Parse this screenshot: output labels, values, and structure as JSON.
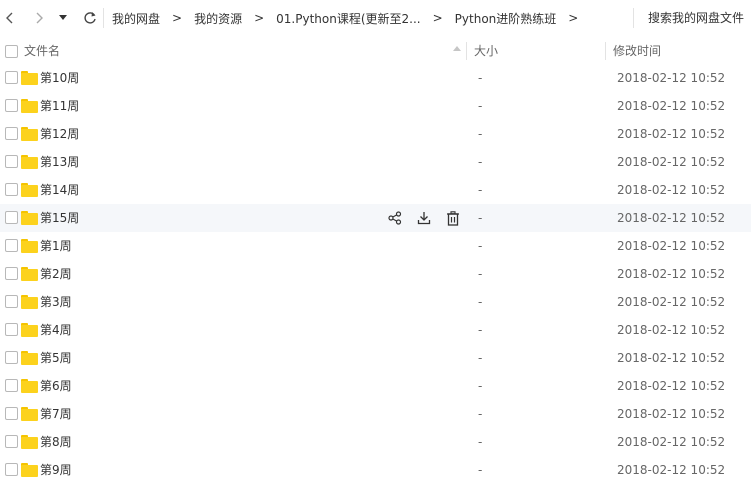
{
  "toolbar": {
    "back_icon": "chevron-left-icon",
    "forward_icon": "chevron-right-icon",
    "history_icon": "caret-down-icon",
    "refresh_icon": "refresh-icon",
    "breadcrumb": [
      {
        "label": "我的网盘"
      },
      {
        "label": "我的资源"
      },
      {
        "label": "01.Python课程(更新至2..."
      },
      {
        "label": "Python进阶熟练班"
      }
    ],
    "separator": ">",
    "search_label": "搜索我的网盘文件"
  },
  "header": {
    "name": "文件名",
    "size": "大小",
    "modified": "修改时间"
  },
  "rows": [
    {
      "name": "第10周",
      "size": "-",
      "date": "2018-02-12 10:52"
    },
    {
      "name": "第11周",
      "size": "-",
      "date": "2018-02-12 10:52"
    },
    {
      "name": "第12周",
      "size": "-",
      "date": "2018-02-12 10:52"
    },
    {
      "name": "第13周",
      "size": "-",
      "date": "2018-02-12 10:52"
    },
    {
      "name": "第14周",
      "size": "-",
      "date": "2018-02-12 10:52"
    },
    {
      "name": "第15周",
      "size": "-",
      "date": "2018-02-12 10:52",
      "hovered": true,
      "actions": [
        "share-icon",
        "download-icon",
        "delete-icon"
      ]
    },
    {
      "name": "第1周",
      "size": "-",
      "date": "2018-02-12 10:52"
    },
    {
      "name": "第2周",
      "size": "-",
      "date": "2018-02-12 10:52"
    },
    {
      "name": "第3周",
      "size": "-",
      "date": "2018-02-12 10:52"
    },
    {
      "name": "第4周",
      "size": "-",
      "date": "2018-02-12 10:52"
    },
    {
      "name": "第5周",
      "size": "-",
      "date": "2018-02-12 10:52"
    },
    {
      "name": "第6周",
      "size": "-",
      "date": "2018-02-12 10:52"
    },
    {
      "name": "第7周",
      "size": "-",
      "date": "2018-02-12 10:52"
    },
    {
      "name": "第8周",
      "size": "-",
      "date": "2018-02-12 10:52"
    },
    {
      "name": "第9周",
      "size": "-",
      "date": "2018-02-12 10:52"
    }
  ],
  "colors": {
    "folder": "#fcd21d",
    "hover_row": "#f5f7fa",
    "text": "#333333",
    "muted": "#666666"
  }
}
